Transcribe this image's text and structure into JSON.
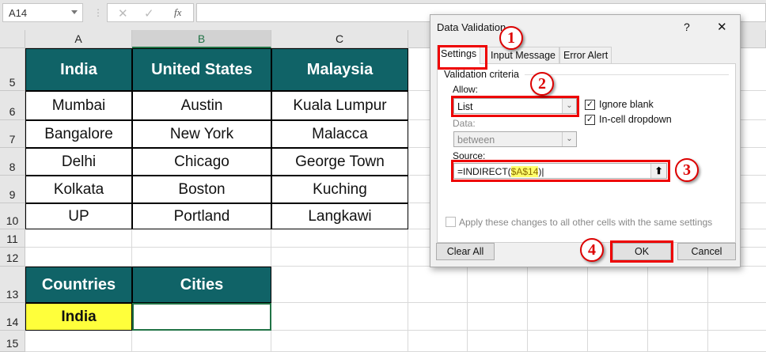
{
  "formula_bar": {
    "name_box": "A14",
    "cancel_icon": "✕",
    "enter_icon": "✓",
    "fx_label": "fx",
    "formula": ""
  },
  "columns": [
    "A",
    "B",
    "C",
    "",
    "",
    "",
    "",
    "",
    "",
    ""
  ],
  "rows": [
    "5",
    "6",
    "7",
    "8",
    "9",
    "10",
    "11",
    "12",
    "13",
    "14",
    "15"
  ],
  "table": {
    "headers": [
      "India",
      "United States",
      "Malaysia"
    ],
    "rows": [
      [
        "Mumbai",
        "Austin",
        "Kuala Lumpur"
      ],
      [
        "Bangalore",
        "New York",
        "Malacca"
      ],
      [
        "Delhi",
        "Chicago",
        "George Town"
      ],
      [
        "Kolkata",
        "Boston",
        "Kuching"
      ],
      [
        "UP",
        "Portland",
        "Langkawi"
      ]
    ]
  },
  "lookup": {
    "headers": [
      "Countries",
      "Cities"
    ],
    "country": "India",
    "city": ""
  },
  "dialog": {
    "title": "Data Validation",
    "help": "?",
    "close": "✕",
    "tabs": [
      "Settings",
      "Input Message",
      "Error Alert"
    ],
    "group": "Validation criteria",
    "allow_label": "Allow:",
    "allow_value": "List",
    "ignore_blank": "Ignore blank",
    "in_cell_dropdown": "In-cell dropdown",
    "data_label": "Data:",
    "data_value": "between",
    "source_label": "Source:",
    "source_prefix": "=INDIRECT(",
    "source_ref": "$A$14",
    "source_suffix": ")",
    "apply_all": "Apply these changes to all other cells with the same settings",
    "clear_all": "Clear All",
    "ok": "OK",
    "cancel": "Cancel"
  },
  "steps": [
    "1",
    "2",
    "3",
    "4"
  ],
  "colors": {
    "header_teal": "#106367",
    "highlight_yellow": "#ffff3b",
    "annotation_red": "#e00000"
  }
}
